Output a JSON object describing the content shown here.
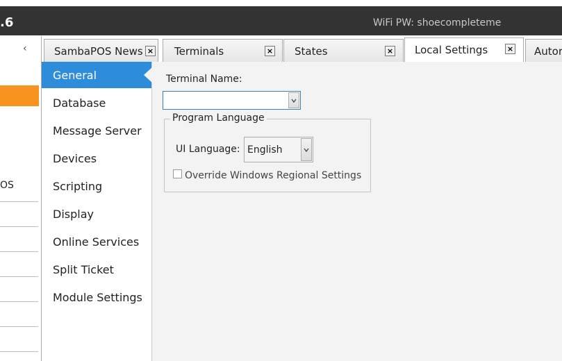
{
  "app": {
    "version_partial": ".6",
    "wifi_text": "WiFi PW: shoecompleteme"
  },
  "left_strip": {
    "collapse_glyph": "‹",
    "partial_label": "OS"
  },
  "tabs": [
    {
      "label": "SambaPOS News",
      "close": "×",
      "active": false
    },
    {
      "label": "Terminals",
      "close": "×",
      "active": false
    },
    {
      "label": "States",
      "close": "×",
      "active": false
    },
    {
      "label": "Local Settings",
      "close": "×",
      "active": true
    },
    {
      "label": "Autor",
      "active": false
    }
  ],
  "settings_nav": {
    "items": [
      {
        "label": "General",
        "selected": true
      },
      {
        "label": "Database"
      },
      {
        "label": "Message Server"
      },
      {
        "label": "Devices"
      },
      {
        "label": "Scripting"
      },
      {
        "label": "Display"
      },
      {
        "label": "Online Services"
      },
      {
        "label": "Split Ticket"
      },
      {
        "label": "Module Settings"
      }
    ]
  },
  "general": {
    "terminal_name_label": "Terminal Name:",
    "terminal_name_value": "",
    "program_language_title": "Program Language",
    "ui_language_label": "UI Language:",
    "ui_language_value": "English",
    "override_label": "Override Windows Regional Settings",
    "override_checked": false
  },
  "colors": {
    "accent_orange": "#f7931e",
    "selected_blue": "#2e8ddb",
    "titlebar": "#333333"
  },
  "icons": {
    "dropdown": "chevron-down-icon",
    "close": "close-icon"
  }
}
